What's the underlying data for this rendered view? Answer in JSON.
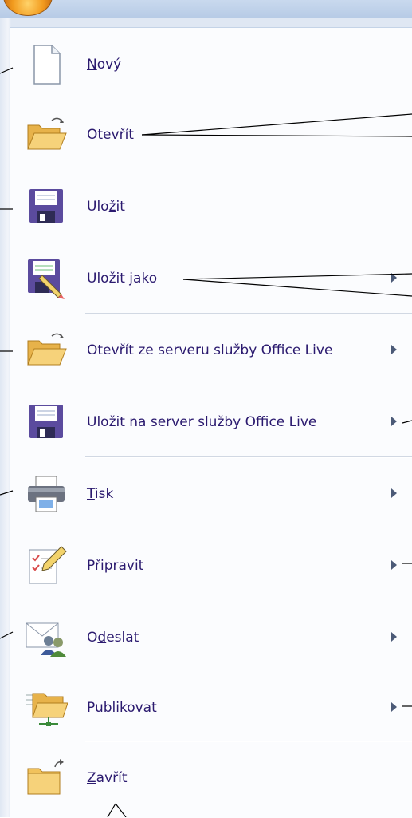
{
  "menu": {
    "items": [
      {
        "id": "new",
        "before": "",
        "accel": "N",
        "after": "ový",
        "has_submenu": false,
        "icon": "document-new-icon"
      },
      {
        "id": "open",
        "before": "",
        "accel": "O",
        "after": "tevřít",
        "has_submenu": false,
        "icon": "folder-open-icon"
      },
      {
        "id": "save",
        "before": "Ulo",
        "accel": "ž",
        "after": "it",
        "has_submenu": false,
        "icon": "floppy-disk-icon"
      },
      {
        "id": "save-as",
        "before": "Uložit ",
        "accel": "j",
        "after": "ako",
        "has_submenu": true,
        "icon": "save-as-pencil-icon"
      },
      {
        "id": "open-office-live",
        "before": "Otevřít ze serveru služby Office Live",
        "accel": "",
        "after": "",
        "has_submenu": true,
        "icon": "folder-open-icon"
      },
      {
        "id": "save-office-live",
        "before": "Uložit na server služby Office Live",
        "accel": "",
        "after": "",
        "has_submenu": true,
        "icon": "floppy-disk-icon"
      },
      {
        "id": "print",
        "before": "",
        "accel": "T",
        "after": "isk",
        "has_submenu": true,
        "icon": "printer-icon"
      },
      {
        "id": "prepare",
        "before": "Př",
        "accel": "i",
        "after": "pravit",
        "has_submenu": true,
        "icon": "checklist-pencil-icon"
      },
      {
        "id": "send",
        "before": "O",
        "accel": "d",
        "after": "eslat",
        "has_submenu": true,
        "icon": "email-people-icon"
      },
      {
        "id": "publish",
        "before": "Pu",
        "accel": "b",
        "after": "likovat",
        "has_submenu": true,
        "icon": "network-folder-icon"
      },
      {
        "id": "close",
        "before": "",
        "accel": "Z",
        "after": "avřít",
        "has_submenu": false,
        "icon": "folder-close-icon"
      }
    ]
  },
  "colors": {
    "label": "#2b1a6f",
    "folder": "#f1c25c",
    "floppy": "#5b4b9e"
  }
}
